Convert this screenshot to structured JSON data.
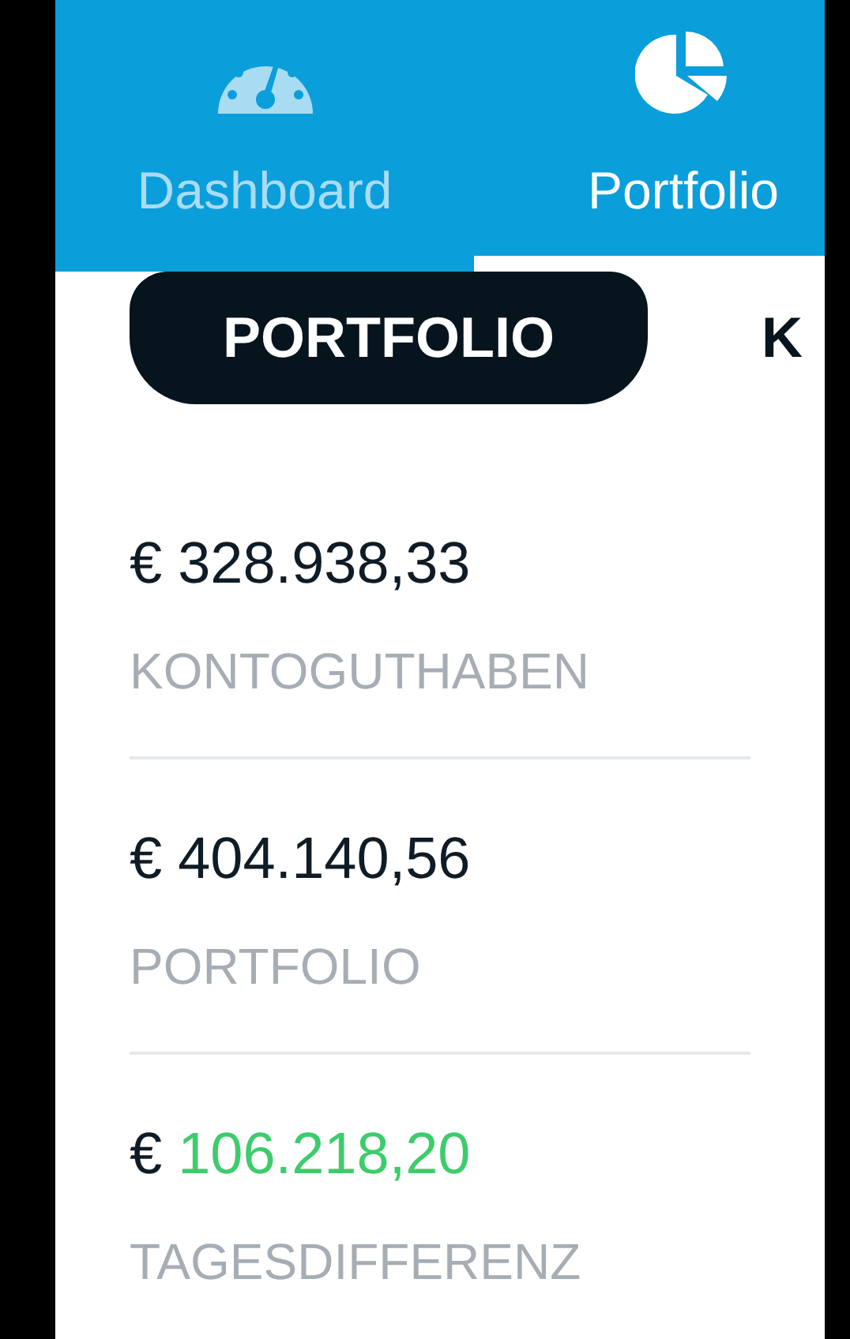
{
  "tabs": [
    {
      "label": "Dashboard",
      "selected": false
    },
    {
      "label": "Portfolio",
      "selected": true
    }
  ],
  "segments": [
    {
      "label": "PORTFOLIO",
      "selected": true
    },
    {
      "label": "K",
      "selected": false
    }
  ],
  "stats": [
    {
      "currency": "€",
      "amount": "328.938,33",
      "positive": false,
      "label": "KONTOGUTHABEN"
    },
    {
      "currency": "€",
      "amount": "404.140,56",
      "positive": false,
      "label": "PORTFOLIO"
    },
    {
      "currency": "€",
      "amount": "106.218,20",
      "positive": true,
      "label": "TAGESDIFFERENZ"
    }
  ]
}
